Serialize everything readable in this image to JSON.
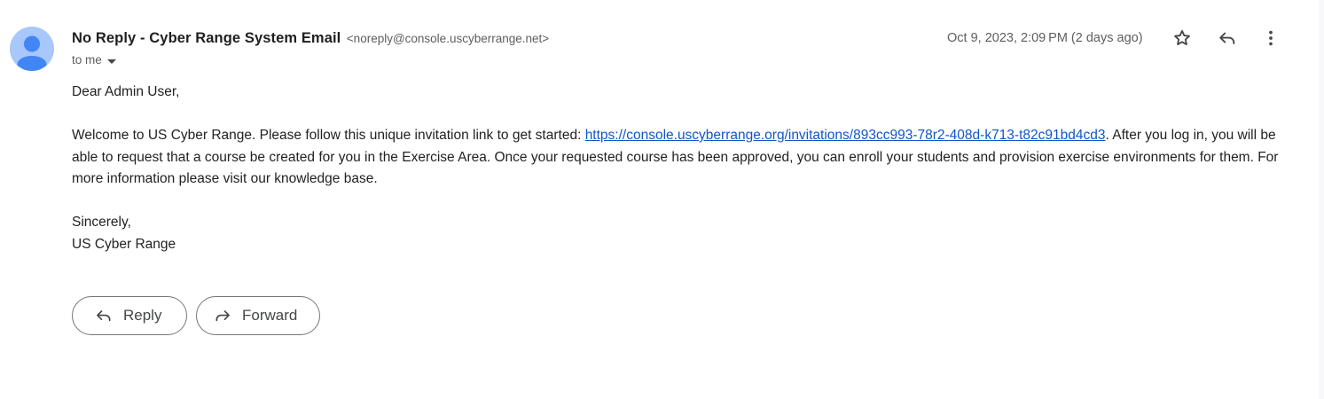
{
  "header": {
    "sender_name": "No Reply - Cyber Range System Email",
    "sender_email": "<noreply@console.uscyberrange.net>",
    "to_label": "to me",
    "date": "Oct 9, 2023, 2:09 PM (2 days ago)"
  },
  "body": {
    "greeting": "Dear Admin User,",
    "p1_before_link": "Welcome to US Cyber Range. Please follow this unique invitation link to get started: ",
    "link": "https://console.uscyberrange.org/invitations/893cc993-78r2-408d-k713-t82c91bd4cd3",
    "p1_after_link": ". After you log in, you will be able to request that a course be created for you in the Exercise Area. Once your requested course has been approved, you can enroll your students and provision exercise environments for them. For more information please visit our knowledge base.",
    "closing": "Sincerely,",
    "signature": "US Cyber Range"
  },
  "actions": {
    "reply_label": "Reply",
    "forward_label": "Forward"
  },
  "icons": {
    "avatar": "person-avatar-icon",
    "star": "star-icon",
    "reply": "reply-icon",
    "more": "more-vert-icon",
    "forward": "forward-icon",
    "to_dropdown": "caret-down-icon"
  },
  "colors": {
    "link": "#1155cc",
    "avatar_bg": "#a8c7fa",
    "avatar_fg": "#4285f4"
  }
}
